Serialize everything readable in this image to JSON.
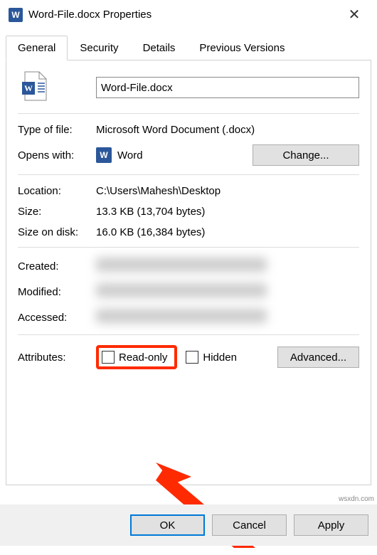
{
  "title": "Word-File.docx Properties",
  "tabs": {
    "general": "General",
    "security": "Security",
    "details": "Details",
    "prev": "Previous Versions"
  },
  "file": {
    "name": "Word-File.docx",
    "type_label": "Type of file:",
    "type_value": "Microsoft Word Document (.docx)",
    "opens_label": "Opens with:",
    "opens_value": "Word",
    "change_btn": "Change...",
    "location_label": "Location:",
    "location_value": "C:\\Users\\Mahesh\\Desktop",
    "size_label": "Size:",
    "size_value": "13.3 KB (13,704 bytes)",
    "size_disk_label": "Size on disk:",
    "size_disk_value": "16.0 KB (16,384 bytes)",
    "created_label": "Created:",
    "modified_label": "Modified:",
    "accessed_label": "Accessed:",
    "attributes_label": "Attributes:",
    "readonly_label": "Read-only",
    "hidden_label": "Hidden",
    "advanced_btn": "Advanced..."
  },
  "buttons": {
    "ok": "OK",
    "cancel": "Cancel",
    "apply": "Apply"
  },
  "watermark": "wsxdn.com"
}
